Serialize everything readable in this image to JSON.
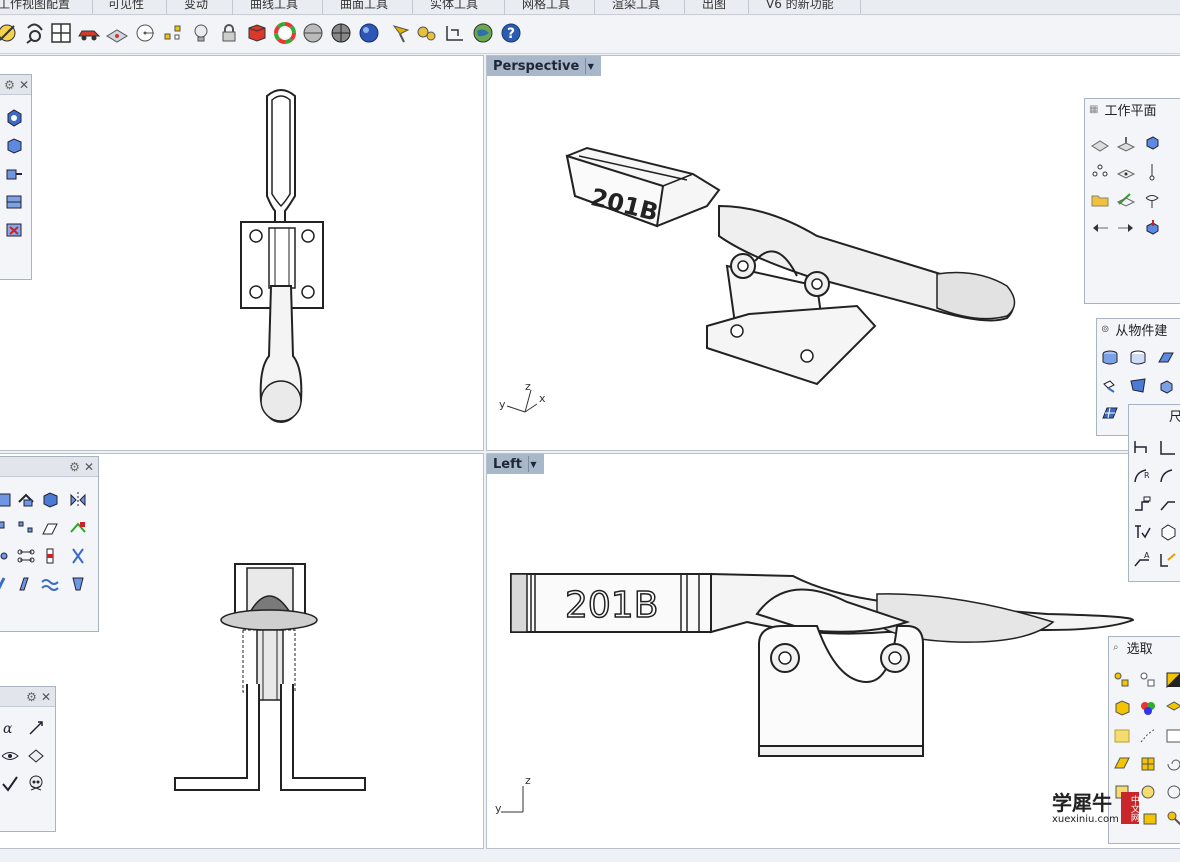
{
  "menu_tabs": [
    "工作视图配置",
    "可见性",
    "变动",
    "曲线工具",
    "曲面工具",
    "实体工具",
    "网格工具",
    "渲染工具",
    "出图",
    "V6 的新功能"
  ],
  "toolbar_icons": [
    "snap-icon",
    "pan-icon",
    "four-viewports-icon",
    "car-icon",
    "plane-icon",
    "circle-target-icon",
    "points-icon",
    "bulb-icon",
    "lock-icon",
    "shaded-icon",
    "color-wheel-icon",
    "sphere-gray-icon",
    "sphere-dark-icon",
    "sphere-blue-icon",
    "flag-icon",
    "gear-group-icon",
    "dimension-icon",
    "globe-icon",
    "help-icon"
  ],
  "viewports": {
    "perspective": {
      "label": "Perspective"
    },
    "left": {
      "label": "Left"
    }
  },
  "axes": {
    "x": "x",
    "y": "y",
    "z": "z"
  },
  "part_label": "201B",
  "panels": {
    "work_plane": {
      "title": "工作平面"
    },
    "from_object": {
      "title": "从物件建"
    },
    "dimension": {
      "title": "尺"
    },
    "select": {
      "title": "选取"
    }
  },
  "watermark": {
    "cn": "学犀牛",
    "url": "xuexiniu.com",
    "badge": "中文网"
  }
}
